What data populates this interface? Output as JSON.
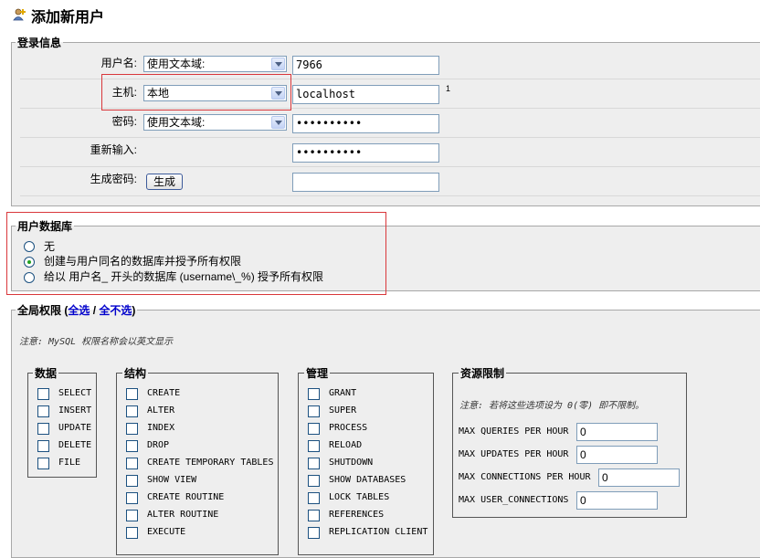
{
  "page_title": "添加新用户",
  "login": {
    "legend": "登录信息",
    "username_label": "用户名:",
    "username_mode": "使用文本域:",
    "username_value": "7966",
    "host_label": "主机:",
    "host_mode": "本地",
    "host_value": "localhost",
    "host_footnote": "1",
    "password_label": "密码:",
    "password_mode": "使用文本域:",
    "password_value": "••••••••••",
    "retype_label": "重新输入:",
    "retype_value": "••••••••••",
    "generate_label": "生成密码:",
    "generate_button": "生成"
  },
  "userdb": {
    "legend": "用户数据库",
    "options": [
      {
        "label": "无",
        "checked": false
      },
      {
        "label": "创建与用户同名的数据库并授予所有权限",
        "checked": true
      },
      {
        "label": "给以 用户名_ 开头的数据库 (username\\_%) 授予所有权限",
        "checked": false
      }
    ]
  },
  "global": {
    "legend_prefix": "全局权限 (",
    "check_all": "全选",
    "separator": " / ",
    "uncheck_all": "全不选",
    "legend_suffix": ")",
    "note": "注意: MySQL 权限名称会以英文显示",
    "groups": {
      "data": {
        "title": "数据",
        "items": [
          "SELECT",
          "INSERT",
          "UPDATE",
          "DELETE",
          "FILE"
        ]
      },
      "structure": {
        "title": "结构",
        "items": [
          "CREATE",
          "ALTER",
          "INDEX",
          "DROP",
          "CREATE TEMPORARY TABLES",
          "SHOW VIEW",
          "CREATE ROUTINE",
          "ALTER ROUTINE",
          "EXECUTE"
        ]
      },
      "admin": {
        "title": "管理",
        "items": [
          "GRANT",
          "SUPER",
          "PROCESS",
          "RELOAD",
          "SHUTDOWN",
          "SHOW DATABASES",
          "LOCK TABLES",
          "REFERENCES",
          "REPLICATION CLIENT"
        ]
      },
      "limits": {
        "title": "资源限制",
        "note": "注意: 若将这些选项设为 0(零) 即不限制。",
        "items": [
          {
            "label": "MAX QUERIES PER HOUR",
            "value": "0"
          },
          {
            "label": "MAX UPDATES PER HOUR",
            "value": "0"
          },
          {
            "label": "MAX CONNECTIONS PER HOUR",
            "value": "0"
          },
          {
            "label": "MAX USER_CONNECTIONS",
            "value": "0"
          }
        ]
      }
    }
  }
}
